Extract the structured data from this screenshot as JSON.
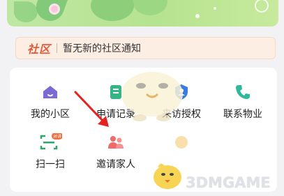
{
  "notice": {
    "tag": "社区",
    "message": "暂无新的社区通知"
  },
  "services": [
    {
      "label": "我的小区",
      "icon": "home-icon",
      "color": "#7b6ad6"
    },
    {
      "label": "申请记录",
      "icon": "record-icon",
      "color": "#35b585"
    },
    {
      "label": "来访授权",
      "icon": "shield-user-icon",
      "color": "#3a7be0"
    },
    {
      "label": "联系物业",
      "icon": "phone-icon",
      "color": "#2fb89a"
    },
    {
      "label": "扫一扫",
      "icon": "scan-icon",
      "color": "#2fa66a",
      "badge": "对讲"
    },
    {
      "label": "邀请家人",
      "icon": "family-icon",
      "color": "#f06a6a"
    }
  ],
  "watermark": "3DMGAME",
  "colors": {
    "notice_tag": "#e55a3c",
    "banner": "#b6e38f",
    "arrow": "#e52222"
  }
}
